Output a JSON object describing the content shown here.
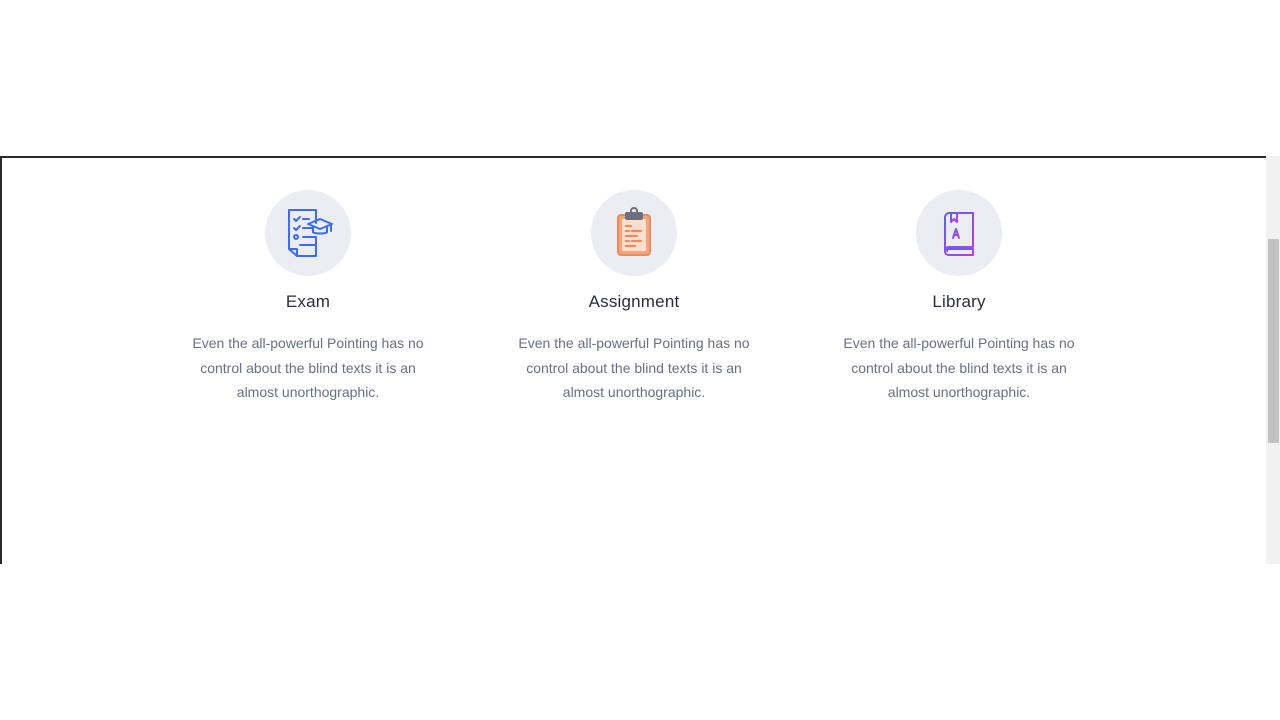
{
  "features": [
    {
      "icon": "exam-icon",
      "title": "Exam",
      "description": "Even the all-powerful Pointing has no control about the blind texts it is an almost unorthographic."
    },
    {
      "icon": "clipboard-icon",
      "title": "Assignment",
      "description": "Even the all-powerful Pointing has no control about the blind texts it is an almost unorthographic."
    },
    {
      "icon": "book-icon",
      "title": "Library",
      "description": "Even the all-powerful Pointing has no control about the blind texts it is an almost unorthographic."
    }
  ],
  "colors": {
    "icon_background": "#ececf3",
    "exam_icon": "#3b6cf5",
    "assignment_icon": "#f08a5d",
    "library_icon_start": "#5b63f0",
    "library_icon_end": "#c03ce0",
    "title_text": "#2b2d3a",
    "body_text": "#6b6f80"
  }
}
